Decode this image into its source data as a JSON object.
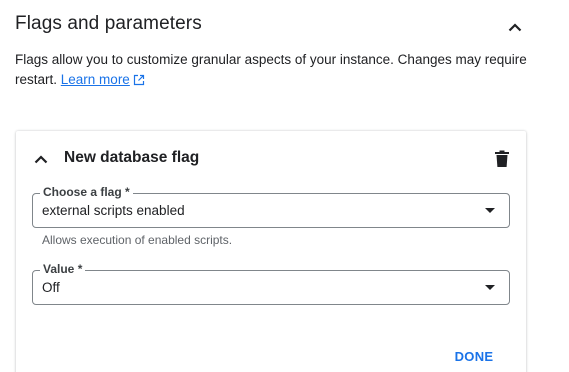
{
  "section": {
    "title": "Flags and parameters",
    "description": "Flags allow you to customize granular aspects of your instance. Changes may require restart.",
    "learn_more": "Learn more"
  },
  "card": {
    "title": "New database flag",
    "flag_field": {
      "label": "Choose a flag *",
      "value": "external scripts enabled",
      "hint": "Allows execution of enabled scripts."
    },
    "value_field": {
      "label": "Value *",
      "value": "Off"
    },
    "done_label": "DONE"
  },
  "colors": {
    "accent": "#1a73e8",
    "text": "#202124",
    "border": "#80868b",
    "hint": "#5f6368"
  }
}
